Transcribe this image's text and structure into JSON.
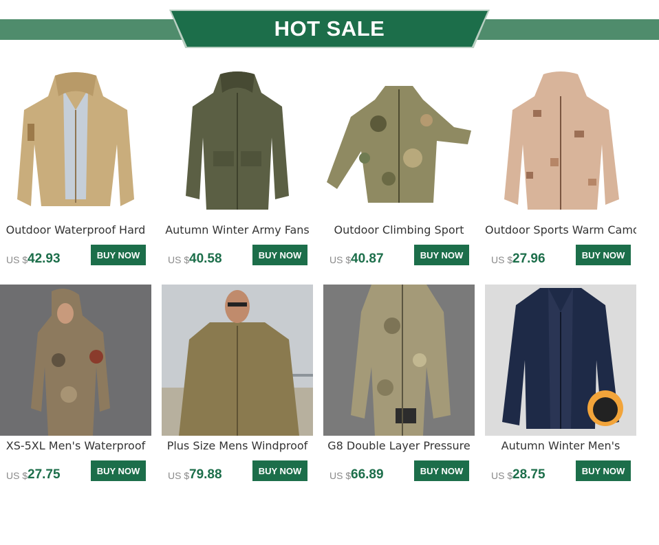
{
  "banner": {
    "title": "HOT SALE"
  },
  "products": [
    {
      "name": "Outdoor Waterproof Hard",
      "currency": "US $",
      "price": "42.93",
      "button": "BUY NOW",
      "image": "khaki-hooded-jacket"
    },
    {
      "name": "Autumn Winter Army Fans",
      "currency": "US $",
      "price": "40.58",
      "button": "BUY NOW",
      "image": "army-green-field-jacket"
    },
    {
      "name": "Outdoor Climbing Sport",
      "currency": "US $",
      "price": "40.87",
      "button": "BUY NOW",
      "image": "camo-softshell-jacket"
    },
    {
      "name": "Outdoor Sports Warm Camo",
      "currency": "US $",
      "price": "27.96",
      "button": "BUY NOW",
      "image": "desert-camo-hoodie"
    },
    {
      "name": "XS-5XL Men's Waterproof",
      "currency": "US $",
      "price": "27.75",
      "button": "BUY NOW",
      "image": "model-camo-hooded-jacket"
    },
    {
      "name": "Plus Size Mens Windproof",
      "currency": "US $",
      "price": "79.88",
      "button": "BUY NOW",
      "image": "model-khaki-jacket-bridge"
    },
    {
      "name": "G8 Double Layer Pressure",
      "currency": "US $",
      "price": "66.89",
      "button": "BUY NOW",
      "image": "model-camo-tactical-jacket"
    },
    {
      "name": "Autumn Winter Men's",
      "currency": "US $",
      "price": "28.75",
      "button": "BUY NOW",
      "image": "navy-fleece-jacket"
    }
  ],
  "colors": {
    "brand": "#1c6e4a",
    "banner_strip": "#4f8c6c",
    "price": "#1c6e4a",
    "currency": "#8a8a8a"
  }
}
